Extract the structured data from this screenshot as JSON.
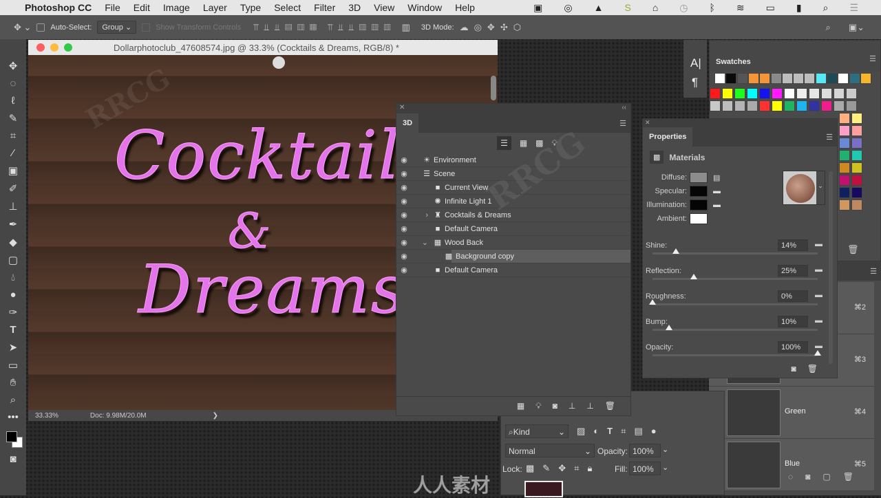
{
  "menubar": {
    "apple": "",
    "app": "Photoshop CC",
    "items": [
      "File",
      "Edit",
      "Image",
      "Layer",
      "Type",
      "Select",
      "Filter",
      "3D",
      "View",
      "Window",
      "Help"
    ],
    "status_icons": [
      "display-icon",
      "creative-cloud-icon",
      "drive-icon",
      "s-icon",
      "home-upload-icon",
      "time-machine-icon",
      "bluetooth-icon",
      "wifi-icon",
      "airplay-icon",
      "battery-icon",
      "spotlight-icon",
      "list-icon"
    ]
  },
  "options": {
    "auto_select_label": "Auto-Select:",
    "auto_select_value": "Group",
    "show_transform": "Show Transform Controls",
    "mode_3d": "3D Mode:"
  },
  "document": {
    "title": "Dollarphotoclub_47608574.jpg @ 33.3% (Cocktails & Dreams, RGB/8) *",
    "canvas_text": {
      "line1": "Cocktails",
      "line2": "&",
      "line3": "Dreams"
    },
    "zoom": "33.33%",
    "doc_size": "Doc: 9.98M/20.0M",
    "arrow": "❯"
  },
  "panel3d": {
    "tab": "3D",
    "rows": [
      {
        "label": "Environment",
        "icon": "☀",
        "indent": 0,
        "twirl": ""
      },
      {
        "label": "Scene",
        "icon": "☰",
        "indent": 0,
        "twirl": ""
      },
      {
        "label": "Current View",
        "icon": "■",
        "indent": 1,
        "twirl": ""
      },
      {
        "label": "Infinite Light 1",
        "icon": "✺",
        "indent": 1,
        "twirl": ""
      },
      {
        "label": "Cocktails & Dreams",
        "icon": "♜",
        "indent": 1,
        "twirl": "›"
      },
      {
        "label": "Default Camera",
        "icon": "■",
        "indent": 1,
        "twirl": ""
      },
      {
        "label": "Wood Back",
        "icon": "▦",
        "indent": 1,
        "twirl": "⌄"
      },
      {
        "label": "Background copy",
        "icon": "▩",
        "indent": 2,
        "twirl": ""
      },
      {
        "label": "Default Camera",
        "icon": "■",
        "indent": 1,
        "twirl": ""
      }
    ]
  },
  "swatches": {
    "title": "Swatches",
    "row1": [
      "#ffffff",
      "#0a0a0a",
      "#555555",
      "#f5953a",
      "#f5953a",
      "#8a8a8a",
      "#bdbdbd",
      "#bdbdbd",
      "#bdbdbd",
      "#57e8f5",
      "#1e4a55",
      "#ffffff",
      "#2f6e80",
      "#f8b42a"
    ],
    "row2": [
      "#ff1a1a",
      "#ffff00",
      "#1eff1e",
      "#00ffff",
      "#1414f0",
      "#ff1aff",
      "#ffffff",
      "#eeeeee",
      "#e6e6e6",
      "#dddddd",
      "#d6d6d6",
      "#cccccc"
    ],
    "row3": [
      "#c8c8c8",
      "#bdbdbd",
      "#b4b4b4",
      "#aaaaaa",
      "#ff3232",
      "#ffff00",
      "#1eb464",
      "#1eb4f0",
      "#3232a0",
      "#f01e8c",
      "#aaaaaa",
      "#999999"
    ],
    "side": [
      [
        "#ffb080",
        "#fff080"
      ],
      [
        "#ffa0c8",
        "#ffa0a0"
      ],
      [
        "#6a8ad8",
        "#7a70c8"
      ],
      [
        "#20b070",
        "#20c8b0"
      ],
      [
        "#d08820",
        "#d0c020"
      ],
      [
        "#c01070",
        "#c01040"
      ],
      [
        "#102060",
        "#180860"
      ],
      [
        "#d09860",
        "#c08860"
      ]
    ]
  },
  "properties": {
    "title": "Properties",
    "section": "Materials",
    "diffuse": "Diffuse:",
    "specular": "Specular:",
    "illumination": "Illumination:",
    "ambient": "Ambient:",
    "colors": {
      "diffuse": "#8c8c8c",
      "specular": "#050505",
      "illumination": "#050505",
      "ambient": "#ffffff"
    },
    "sliders": [
      {
        "label": "Shine:",
        "value": "14%",
        "pct": 14
      },
      {
        "label": "Reflection:",
        "value": "25%",
        "pct": 25
      },
      {
        "label": "Roughness:",
        "value": "0%",
        "pct": 0
      },
      {
        "label": "Bump:",
        "value": "10%",
        "pct": 10
      },
      {
        "label": "Opacity:",
        "value": "100%",
        "pct": 100
      }
    ]
  },
  "layers": {
    "filter": "Kind",
    "blend": "Normal",
    "opacity_label": "Opacity:",
    "opacity": "100%",
    "lock_label": "Lock:",
    "fill_label": "Fill:",
    "fill": "100%"
  },
  "channels": [
    {
      "name": "",
      "key": "⌘2"
    },
    {
      "name": "",
      "key": "⌘3"
    },
    {
      "name": "Green",
      "key": "⌘4"
    },
    {
      "name": "Blue",
      "key": "⌘5"
    }
  ],
  "mini_panel": {
    "char": "A|",
    "para": "¶"
  },
  "watermarks": {
    "a": "RRCG",
    "b": "人人素材"
  }
}
